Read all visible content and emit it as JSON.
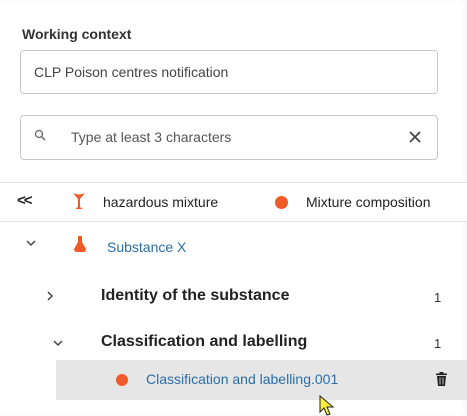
{
  "working_context": {
    "title": "Working context",
    "value": "CLP Poison centres notification"
  },
  "search": {
    "placeholder": "Type at least 3 characters",
    "icon": "search-icon",
    "clear_icon": "close-icon"
  },
  "tabs": {
    "collapse_label": "<<",
    "items": [
      {
        "label": "hazardous mixture",
        "icon": "mixture-flask-icon"
      },
      {
        "label": "Mixture composition",
        "icon": "orange-dot-icon"
      }
    ]
  },
  "tree": {
    "root": {
      "label": "Substance X",
      "expanded": true,
      "icon": "flask-icon"
    },
    "sections": [
      {
        "label": "Identity of the substance",
        "count": "1",
        "expanded": false
      },
      {
        "label": "Classification and labelling",
        "count": "1",
        "expanded": true
      }
    ],
    "selected_document": {
      "label": "Classification and labelling.001",
      "icon": "orange-dot-icon",
      "delete_icon": "trash-icon"
    }
  },
  "colors": {
    "accent_orange": "#f05a28",
    "link_blue": "#2a6ea6",
    "selected_bg": "#e6e6e6"
  }
}
